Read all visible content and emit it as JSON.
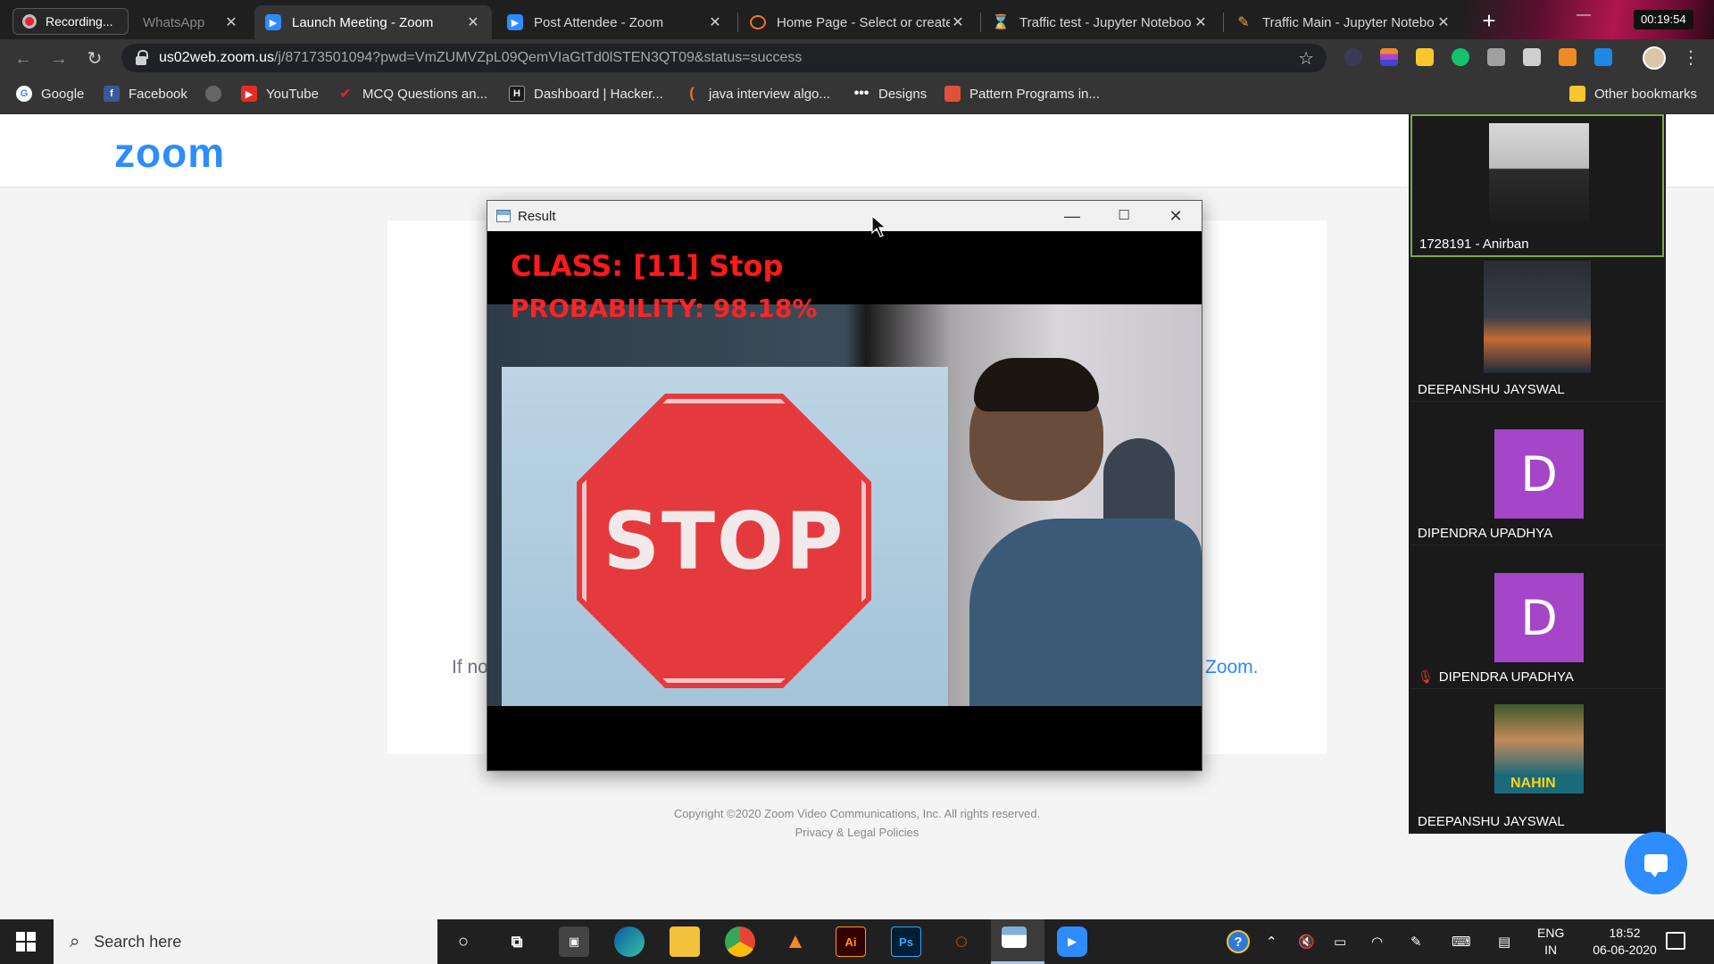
{
  "browser": {
    "recording_label": "Recording...",
    "tabs": [
      {
        "title": "WhatsApp",
        "icon": "whatsapp-icon"
      },
      {
        "title": "Launch Meeting - Zoom",
        "icon": "zoom-icon"
      },
      {
        "title": "Post Attendee - Zoom",
        "icon": "zoom-icon"
      },
      {
        "title": "Home Page - Select or create",
        "icon": "jupyter-icon"
      },
      {
        "title": "Traffic test - Jupyter Noteboo",
        "icon": "hourglass-icon"
      },
      {
        "title": "Traffic Main - Jupyter Notebo",
        "icon": "notebook-icon"
      }
    ],
    "timer": "00:19:54",
    "url_host": "us02web.zoom.us",
    "url_path": "/j/87173501094?pwd=VmZUMVZpL09QemVIaGtTd0lSTEN3QT09&status=success",
    "bookmarks": [
      {
        "label": "Google"
      },
      {
        "label": "Facebook"
      },
      {
        "label": ""
      },
      {
        "label": "YouTube"
      },
      {
        "label": "MCQ Questions an..."
      },
      {
        "label": "Dashboard | Hacker..."
      },
      {
        "label": "java interview algo..."
      },
      {
        "label": "Designs"
      },
      {
        "label": "Pattern Programs in..."
      }
    ],
    "other_bookmarks": "Other bookmarks"
  },
  "zoom_page": {
    "logo": "zoom",
    "partial_text": "If no",
    "partial_link": "Zoom.",
    "copyright": "Copyright ©2020 Zoom Video Communications, Inc. All rights reserved.",
    "legal": "Privacy & Legal Policies"
  },
  "result_window": {
    "title": "Result",
    "class_text": "CLASS:  [11] Stop",
    "probability_text": "PROBABILITY: 98.18%",
    "sign_text": "STOP"
  },
  "participants": [
    {
      "name": "1728191 - Anirban",
      "type": "video"
    },
    {
      "name": "DEEPANSHU JAYSWAL",
      "type": "video"
    },
    {
      "name": "DIPENDRA UPADHYA",
      "type": "avatar",
      "initial": "D"
    },
    {
      "name": "DIPENDRA UPADHYA",
      "type": "avatar",
      "initial": "D",
      "muted": true
    },
    {
      "name": "DEEPANSHU JAYSWAL",
      "type": "video",
      "overlay": "NAHIN"
    }
  ],
  "taskbar": {
    "search_placeholder": "Search here",
    "lang_top": "ENG",
    "lang_bottom": "IN",
    "time": "18:52",
    "date": "06-06-2020"
  },
  "colors": {
    "zoom_blue": "#2D8CFF",
    "avatar_purple": "#a545c8",
    "overlay_red": "#ff1a1a",
    "active_speaker": "#7dab45"
  }
}
